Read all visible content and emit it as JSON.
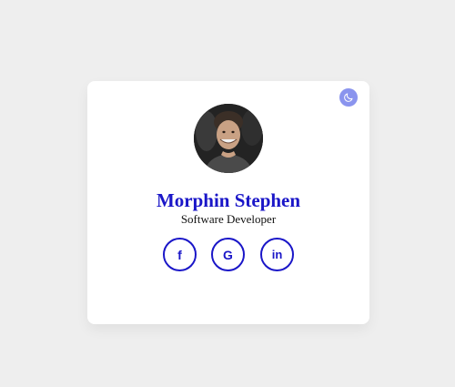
{
  "profile": {
    "name": "Morphin Stephen",
    "role": "Software Developer"
  },
  "socials": [
    {
      "label": "f",
      "icon": "facebook-icon"
    },
    {
      "label": "G",
      "icon": "google-icon"
    },
    {
      "label": "in",
      "icon": "linkedin-icon"
    }
  ],
  "colors": {
    "background": "#eeeeee",
    "card": "#ffffff",
    "accent": "#1a16c8",
    "toggle": "#8a94ee"
  },
  "icons": {
    "theme_toggle": "moon-icon",
    "avatar": "profile-photo"
  }
}
